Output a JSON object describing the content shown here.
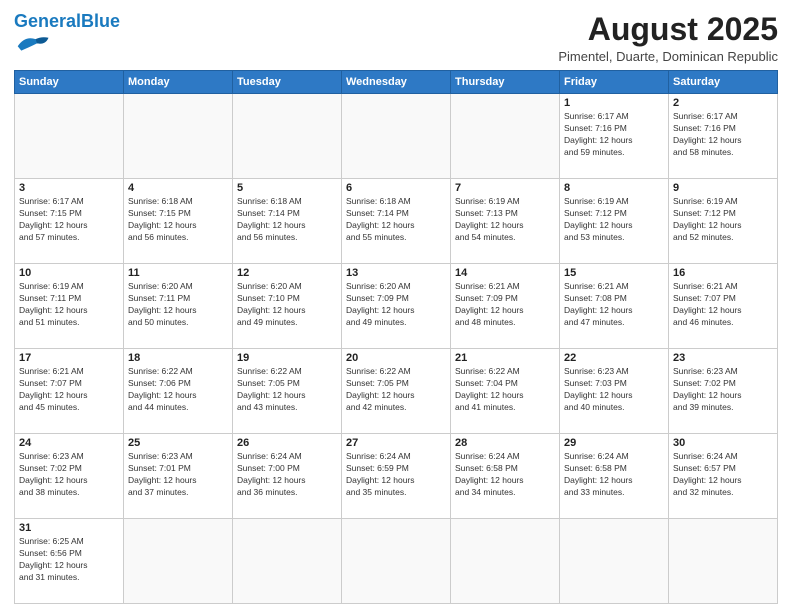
{
  "header": {
    "logo_general": "General",
    "logo_blue": "Blue",
    "month_title": "August 2025",
    "location": "Pimentel, Duarte, Dominican Republic"
  },
  "days_of_week": [
    "Sunday",
    "Monday",
    "Tuesday",
    "Wednesday",
    "Thursday",
    "Friday",
    "Saturday"
  ],
  "weeks": [
    [
      {
        "day": "",
        "info": ""
      },
      {
        "day": "",
        "info": ""
      },
      {
        "day": "",
        "info": ""
      },
      {
        "day": "",
        "info": ""
      },
      {
        "day": "",
        "info": ""
      },
      {
        "day": "1",
        "info": "Sunrise: 6:17 AM\nSunset: 7:16 PM\nDaylight: 12 hours\nand 59 minutes."
      },
      {
        "day": "2",
        "info": "Sunrise: 6:17 AM\nSunset: 7:16 PM\nDaylight: 12 hours\nand 58 minutes."
      }
    ],
    [
      {
        "day": "3",
        "info": "Sunrise: 6:17 AM\nSunset: 7:15 PM\nDaylight: 12 hours\nand 57 minutes."
      },
      {
        "day": "4",
        "info": "Sunrise: 6:18 AM\nSunset: 7:15 PM\nDaylight: 12 hours\nand 56 minutes."
      },
      {
        "day": "5",
        "info": "Sunrise: 6:18 AM\nSunset: 7:14 PM\nDaylight: 12 hours\nand 56 minutes."
      },
      {
        "day": "6",
        "info": "Sunrise: 6:18 AM\nSunset: 7:14 PM\nDaylight: 12 hours\nand 55 minutes."
      },
      {
        "day": "7",
        "info": "Sunrise: 6:19 AM\nSunset: 7:13 PM\nDaylight: 12 hours\nand 54 minutes."
      },
      {
        "day": "8",
        "info": "Sunrise: 6:19 AM\nSunset: 7:12 PM\nDaylight: 12 hours\nand 53 minutes."
      },
      {
        "day": "9",
        "info": "Sunrise: 6:19 AM\nSunset: 7:12 PM\nDaylight: 12 hours\nand 52 minutes."
      }
    ],
    [
      {
        "day": "10",
        "info": "Sunrise: 6:19 AM\nSunset: 7:11 PM\nDaylight: 12 hours\nand 51 minutes."
      },
      {
        "day": "11",
        "info": "Sunrise: 6:20 AM\nSunset: 7:11 PM\nDaylight: 12 hours\nand 50 minutes."
      },
      {
        "day": "12",
        "info": "Sunrise: 6:20 AM\nSunset: 7:10 PM\nDaylight: 12 hours\nand 49 minutes."
      },
      {
        "day": "13",
        "info": "Sunrise: 6:20 AM\nSunset: 7:09 PM\nDaylight: 12 hours\nand 49 minutes."
      },
      {
        "day": "14",
        "info": "Sunrise: 6:21 AM\nSunset: 7:09 PM\nDaylight: 12 hours\nand 48 minutes."
      },
      {
        "day": "15",
        "info": "Sunrise: 6:21 AM\nSunset: 7:08 PM\nDaylight: 12 hours\nand 47 minutes."
      },
      {
        "day": "16",
        "info": "Sunrise: 6:21 AM\nSunset: 7:07 PM\nDaylight: 12 hours\nand 46 minutes."
      }
    ],
    [
      {
        "day": "17",
        "info": "Sunrise: 6:21 AM\nSunset: 7:07 PM\nDaylight: 12 hours\nand 45 minutes."
      },
      {
        "day": "18",
        "info": "Sunrise: 6:22 AM\nSunset: 7:06 PM\nDaylight: 12 hours\nand 44 minutes."
      },
      {
        "day": "19",
        "info": "Sunrise: 6:22 AM\nSunset: 7:05 PM\nDaylight: 12 hours\nand 43 minutes."
      },
      {
        "day": "20",
        "info": "Sunrise: 6:22 AM\nSunset: 7:05 PM\nDaylight: 12 hours\nand 42 minutes."
      },
      {
        "day": "21",
        "info": "Sunrise: 6:22 AM\nSunset: 7:04 PM\nDaylight: 12 hours\nand 41 minutes."
      },
      {
        "day": "22",
        "info": "Sunrise: 6:23 AM\nSunset: 7:03 PM\nDaylight: 12 hours\nand 40 minutes."
      },
      {
        "day": "23",
        "info": "Sunrise: 6:23 AM\nSunset: 7:02 PM\nDaylight: 12 hours\nand 39 minutes."
      }
    ],
    [
      {
        "day": "24",
        "info": "Sunrise: 6:23 AM\nSunset: 7:02 PM\nDaylight: 12 hours\nand 38 minutes."
      },
      {
        "day": "25",
        "info": "Sunrise: 6:23 AM\nSunset: 7:01 PM\nDaylight: 12 hours\nand 37 minutes."
      },
      {
        "day": "26",
        "info": "Sunrise: 6:24 AM\nSunset: 7:00 PM\nDaylight: 12 hours\nand 36 minutes."
      },
      {
        "day": "27",
        "info": "Sunrise: 6:24 AM\nSunset: 6:59 PM\nDaylight: 12 hours\nand 35 minutes."
      },
      {
        "day": "28",
        "info": "Sunrise: 6:24 AM\nSunset: 6:58 PM\nDaylight: 12 hours\nand 34 minutes."
      },
      {
        "day": "29",
        "info": "Sunrise: 6:24 AM\nSunset: 6:58 PM\nDaylight: 12 hours\nand 33 minutes."
      },
      {
        "day": "30",
        "info": "Sunrise: 6:24 AM\nSunset: 6:57 PM\nDaylight: 12 hours\nand 32 minutes."
      }
    ],
    [
      {
        "day": "31",
        "info": "Sunrise: 6:25 AM\nSunset: 6:56 PM\nDaylight: 12 hours\nand 31 minutes."
      },
      {
        "day": "",
        "info": ""
      },
      {
        "day": "",
        "info": ""
      },
      {
        "day": "",
        "info": ""
      },
      {
        "day": "",
        "info": ""
      },
      {
        "day": "",
        "info": ""
      },
      {
        "day": "",
        "info": ""
      }
    ]
  ]
}
